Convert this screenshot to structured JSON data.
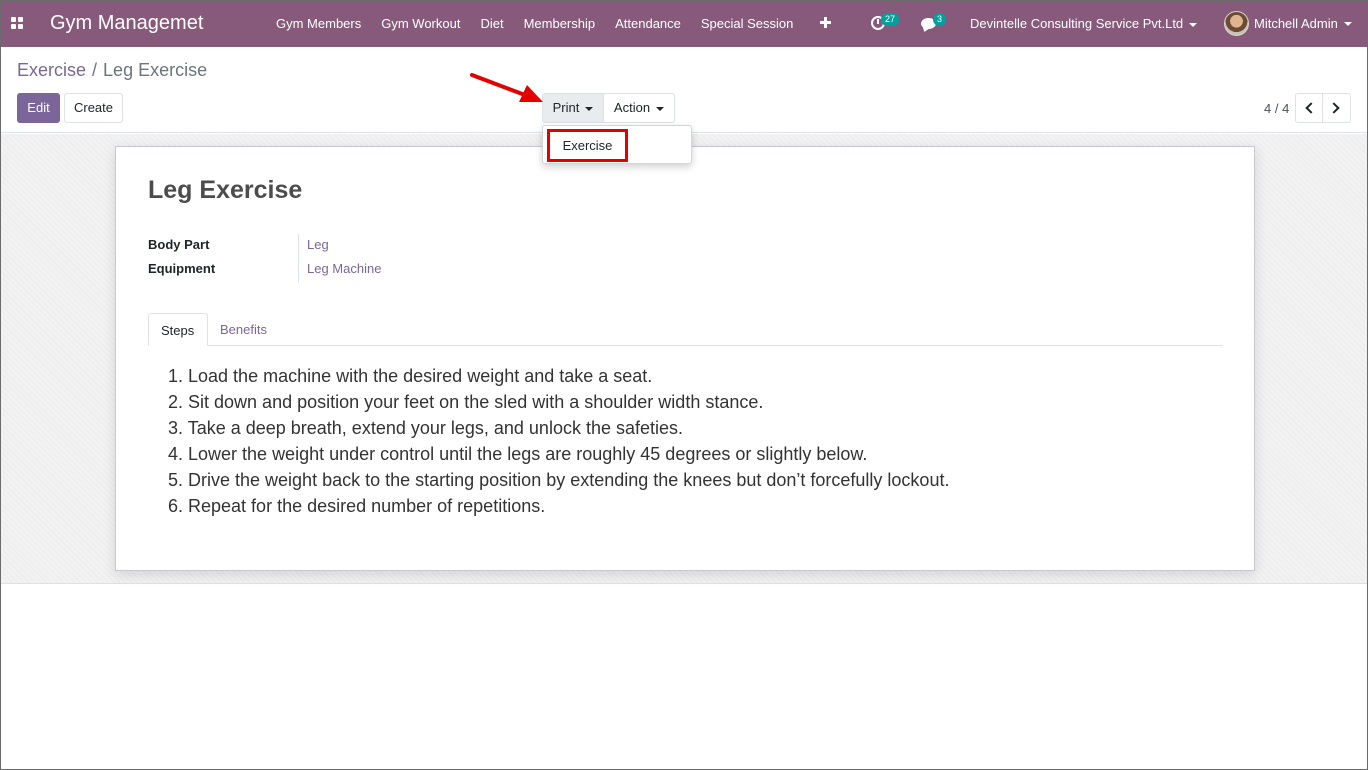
{
  "navbar": {
    "brand": "Gym Managemet",
    "menu": [
      "Gym Members",
      "Gym Workout",
      "Diet",
      "Membership",
      "Attendance",
      "Special Session"
    ],
    "activity_count": "27",
    "message_count": "3",
    "company": "Devintelle Consulting Service Pvt.Ltd",
    "user": "Mitchell Admin",
    "brand_color": "#875a7b"
  },
  "breadcrumb": {
    "parent": "Exercise",
    "separator": "/",
    "current": "Leg Exercise"
  },
  "toolbar": {
    "edit_label": "Edit",
    "create_label": "Create",
    "print_label": "Print",
    "action_label": "Action",
    "accent_color": "#7c6699"
  },
  "pager": {
    "value": "4 / 4"
  },
  "print_dropdown": {
    "items": [
      "Exercise"
    ],
    "highlight_color": "#e30000"
  },
  "record": {
    "title": "Leg Exercise",
    "fields": [
      {
        "label": "Body Part",
        "value": "Leg"
      },
      {
        "label": "Equipment",
        "value": "Leg Machine"
      }
    ],
    "tabs": [
      {
        "label": "Steps",
        "active": true
      },
      {
        "label": "Benefits",
        "active": false
      }
    ],
    "steps": [
      "1. Load the machine with the desired weight and take a seat.",
      "2. Sit down and position your feet on the sled with a shoulder width stance.",
      "3. Take a deep breath, extend your legs, and unlock the safeties.",
      "4. Lower the weight under control until the legs are roughly 45 degrees or slightly below.",
      "5. Drive the weight back to the starting position by extending the knees but don’t forcefully lockout.",
      "6. Repeat for the desired number of repetitions."
    ]
  }
}
